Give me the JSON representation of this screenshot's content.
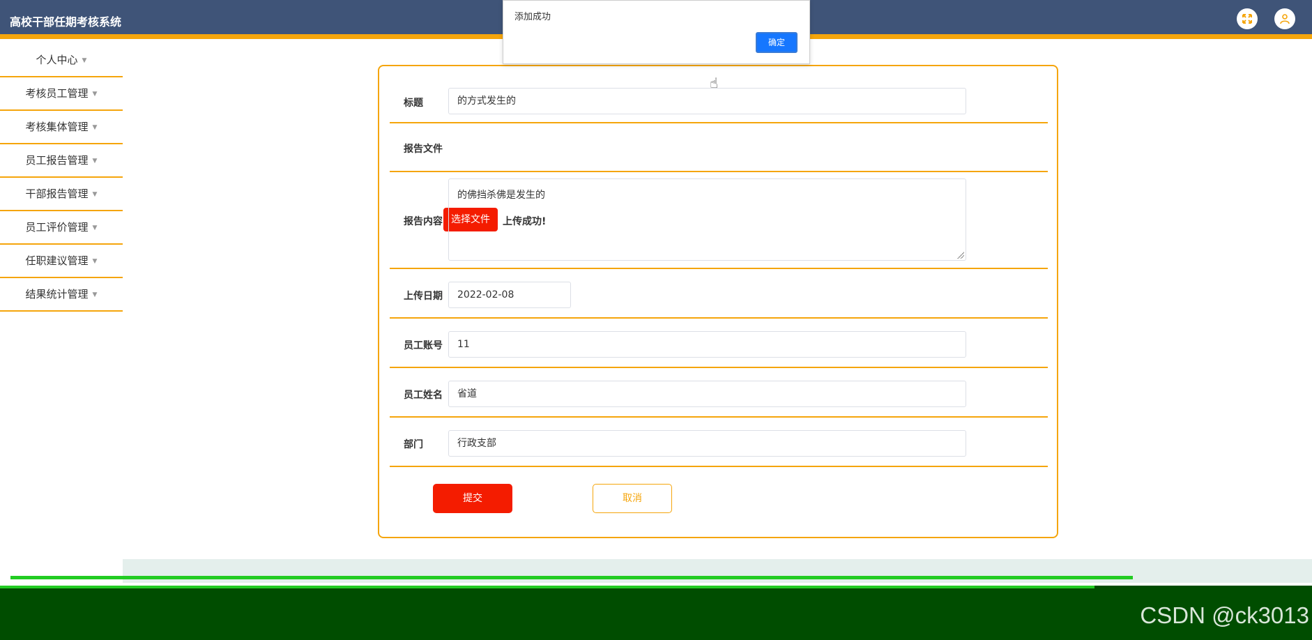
{
  "header": {
    "app_title": "高校干部任期考核系统",
    "icons": [
      "fullscreen-icon",
      "user-icon"
    ]
  },
  "sidebar": {
    "items": [
      {
        "label": "个人中心"
      },
      {
        "label": "考核员工管理"
      },
      {
        "label": "考核集体管理"
      },
      {
        "label": "员工报告管理"
      },
      {
        "label": "干部报告管理"
      },
      {
        "label": "员工评价管理"
      },
      {
        "label": "任职建议管理"
      },
      {
        "label": "结果统计管理"
      }
    ]
  },
  "form": {
    "title": {
      "label": "标题",
      "value": "的方式发生的"
    },
    "report_file": {
      "label": "报告文件",
      "button": "选择文件",
      "status": "上传成功!"
    },
    "report_content": {
      "label": "报告内容",
      "value": "的佛挡杀佛是发生的"
    },
    "upload_date": {
      "label": "上传日期",
      "value": "2022-02-08"
    },
    "employee_account": {
      "label": "员工账号",
      "value": "11"
    },
    "employee_name": {
      "label": "员工姓名",
      "value": "省道"
    },
    "department": {
      "label": "部门",
      "value": "行政支部"
    },
    "submit_label": "提交",
    "cancel_label": "取消"
  },
  "dialog": {
    "message": "添加成功",
    "ok_label": "确定"
  },
  "watermark": "CSDN @ck3013",
  "colors": {
    "header": "#3f5478",
    "accent": "#f5a50b",
    "primary_red": "#f41c00",
    "dialog_blue": "#1677ff"
  }
}
